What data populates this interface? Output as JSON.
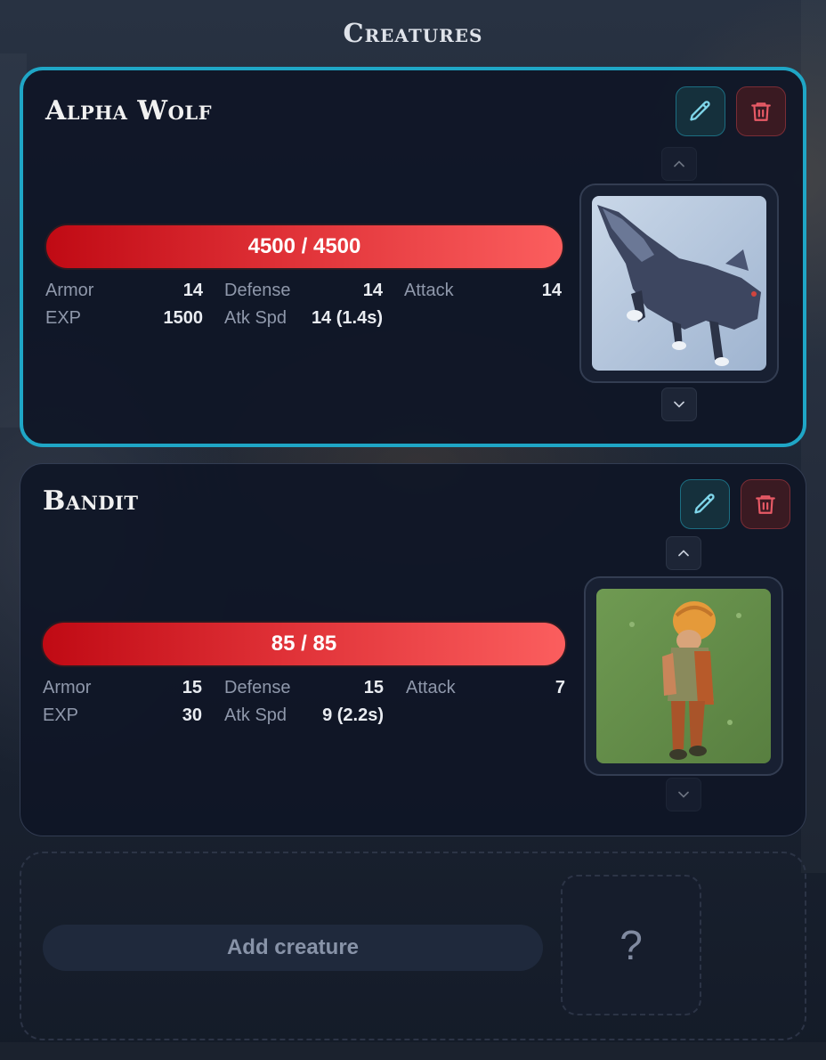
{
  "page": {
    "title": "Creatures"
  },
  "creatures": [
    {
      "name": "Alpha Wolf",
      "hp": "4500 / 4500",
      "hp_fraction": 1.0,
      "stats": {
        "armor_label": "Armor",
        "armor": "14",
        "defense_label": "Defense",
        "defense": "14",
        "attack_label": "Attack",
        "attack": "14",
        "exp_label": "EXP",
        "exp": "1500",
        "atk_spd_label": "Atk Spd",
        "atk_spd": "14 (1.4s)"
      },
      "selected": true
    },
    {
      "name": "Bandit",
      "hp": "85 / 85",
      "hp_fraction": 1.0,
      "stats": {
        "armor_label": "Armor",
        "armor": "15",
        "defense_label": "Defense",
        "defense": "15",
        "attack_label": "Attack",
        "attack": "7",
        "exp_label": "EXP",
        "exp": "30",
        "atk_spd_label": "Atk Spd",
        "atk_spd": "9 (2.2s)"
      },
      "selected": false
    }
  ],
  "add": {
    "button_label": "Add creature",
    "placeholder_symbol": "?"
  },
  "icons": {
    "edit": "pencil-icon",
    "delete": "trash-icon",
    "up": "chevron-up-icon",
    "down": "chevron-down-icon"
  },
  "colors": {
    "accent": "#1fa6c6",
    "hp_start": "#c00a14",
    "hp_end": "#fb5e5e",
    "delete": "#e85a66",
    "edit": "#7fd6ea"
  }
}
